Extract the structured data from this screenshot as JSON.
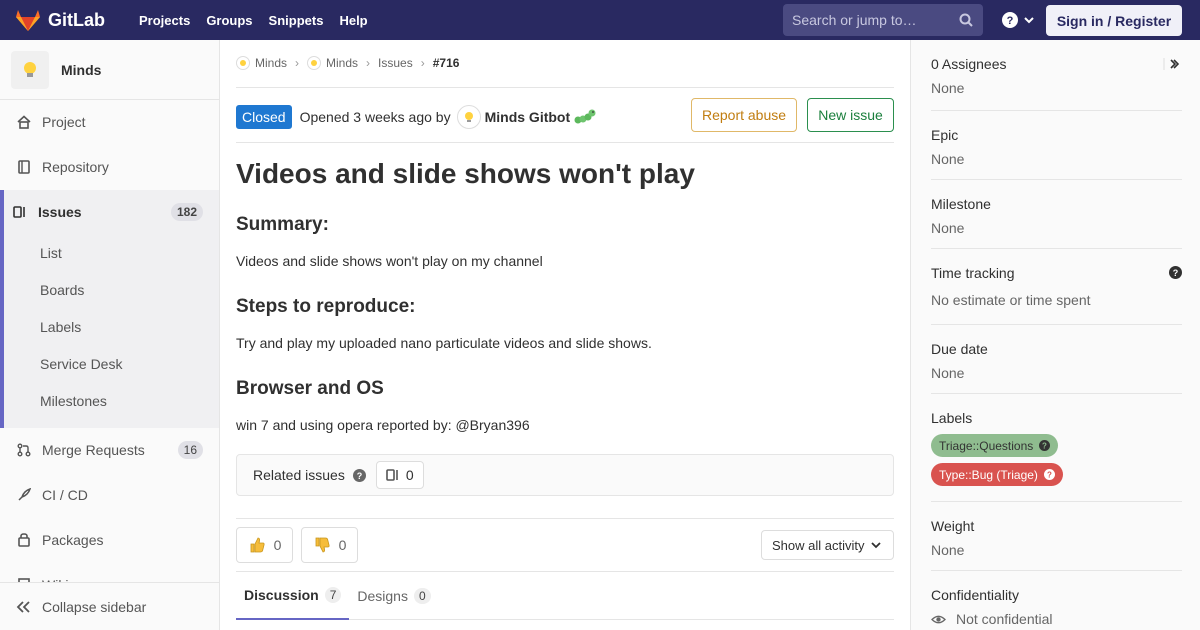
{
  "navbar": {
    "brand": "GitLab",
    "links": [
      "Projects",
      "Groups",
      "Snippets",
      "Help"
    ],
    "search_placeholder": "Search or jump to…",
    "signin": "Sign in / Register"
  },
  "sidebar": {
    "project_name": "Minds",
    "items": {
      "project": "Project",
      "repository": "Repository",
      "issues": "Issues",
      "issues_count": "182",
      "merge_requests": "Merge Requests",
      "merge_requests_count": "16",
      "cicd": "CI / CD",
      "packages": "Packages",
      "wiki": "Wiki"
    },
    "sub_items": [
      "List",
      "Boards",
      "Labels",
      "Service Desk",
      "Milestones"
    ],
    "collapse": "Collapse sidebar"
  },
  "breadcrumb": [
    "Minds",
    "Minds",
    "Issues",
    "#716"
  ],
  "issue": {
    "status": "Closed",
    "opened_text": "Opened 3 weeks ago by",
    "author": "Minds Gitbot",
    "report_abuse": "Report abuse",
    "new_issue": "New issue",
    "title": "Videos and slide shows won't play",
    "sections": [
      {
        "heading": "Summary:",
        "body": "Videos and slide shows won't play on my channel"
      },
      {
        "heading": "Steps to reproduce:",
        "body": "Try and play my uploaded nano particulate videos and slide shows."
      },
      {
        "heading": "Browser and OS",
        "body": "win 7 and using opera reported by: @Bryan396"
      }
    ],
    "related_issues_label": "Related issues",
    "related_issues_count": "0",
    "thumbs_up": "0",
    "thumbs_down": "0",
    "activity_filter": "Show all activity",
    "tabs": [
      {
        "label": "Discussion",
        "count": "7"
      },
      {
        "label": "Designs",
        "count": "0"
      }
    ]
  },
  "right_sidebar": {
    "assignees_title": "0 Assignees",
    "assignees_value": "None",
    "epic_title": "Epic",
    "epic_value": "None",
    "milestone_title": "Milestone",
    "milestone_value": "None",
    "time_tracking_title": "Time tracking",
    "time_tracking_value": "No estimate or time spent",
    "due_date_title": "Due date",
    "due_date_value": "None",
    "labels_title": "Labels",
    "labels": [
      {
        "text": "Triage::Questions",
        "bg": "#8fbc8f",
        "fg": "#333333"
      },
      {
        "text": "Type::Bug (Triage)",
        "bg": "#d9534f",
        "fg": "#ffffff"
      }
    ],
    "weight_title": "Weight",
    "weight_value": "None",
    "confidentiality_title": "Confidentiality",
    "confidentiality_value": "Not confidential"
  },
  "colors": {
    "navbar": "#292961",
    "accent": "#6666c4",
    "closed_badge": "#1f78d1"
  }
}
